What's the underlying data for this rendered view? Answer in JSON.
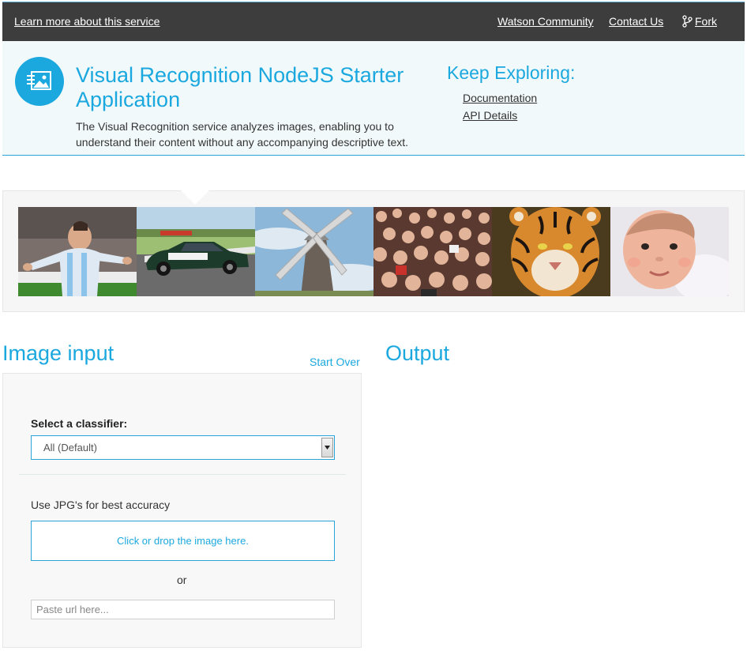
{
  "nav": {
    "learn_more": "Learn more about this service",
    "community": "Watson Community",
    "contact": "Contact Us",
    "fork": "Fork"
  },
  "hero": {
    "title": "Visual Recognition NodeJS Starter Application",
    "description": "The Visual Recognition service analyzes images, enabling you to understand their content without any accompanying descriptive text.",
    "explore_title": "Keep Exploring:",
    "links": [
      "Documentation",
      "API Details"
    ]
  },
  "gallery": {
    "items": [
      "soccer-player",
      "race-car",
      "windmill",
      "crowd",
      "tiger",
      "baby"
    ]
  },
  "input": {
    "title": "Image input",
    "start_over": "Start Over",
    "classifier_label": "Select a classifier:",
    "classifier_value": "All (Default)",
    "jpg_note": "Use JPG's for best accuracy",
    "dropzone": "Click or drop the image here.",
    "or": "or",
    "url_placeholder": "Paste url here..."
  },
  "output": {
    "title": "Output"
  },
  "colors": {
    "accent": "#1ba8df",
    "nav_bg": "#3d3d3d",
    "hero_bg": "#f2f9fb"
  }
}
